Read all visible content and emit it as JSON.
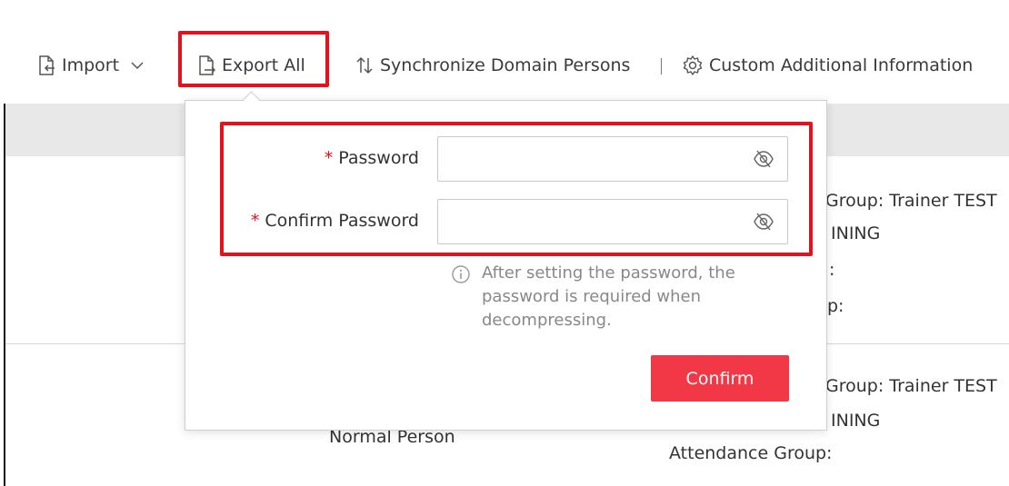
{
  "toolbar": {
    "import_label": "Import",
    "export_all_label": "Export All",
    "sync_label": "Synchronize Domain Persons",
    "custom_info_label": "Custom Additional Information"
  },
  "background_rows": [
    {
      "right_lines": [
        "Group: Trainer TEST",
        "INING",
        ":",
        "p:"
      ]
    },
    {
      "center": "Normal Person",
      "right_lines": [
        "Group: Trainer TEST",
        "INING",
        "Attendance Group:"
      ]
    }
  ],
  "export_dialog": {
    "password_label": "Password",
    "confirm_password_label": "Confirm Password",
    "required_mark": "*",
    "password_value": "",
    "confirm_password_value": "",
    "hint": "After setting the password, the password is required when decompressing.",
    "confirm_button": "Confirm"
  },
  "colors": {
    "highlight": "#e0141e",
    "confirm_button": "#f23847",
    "header_bg": "#e8e8e8"
  }
}
